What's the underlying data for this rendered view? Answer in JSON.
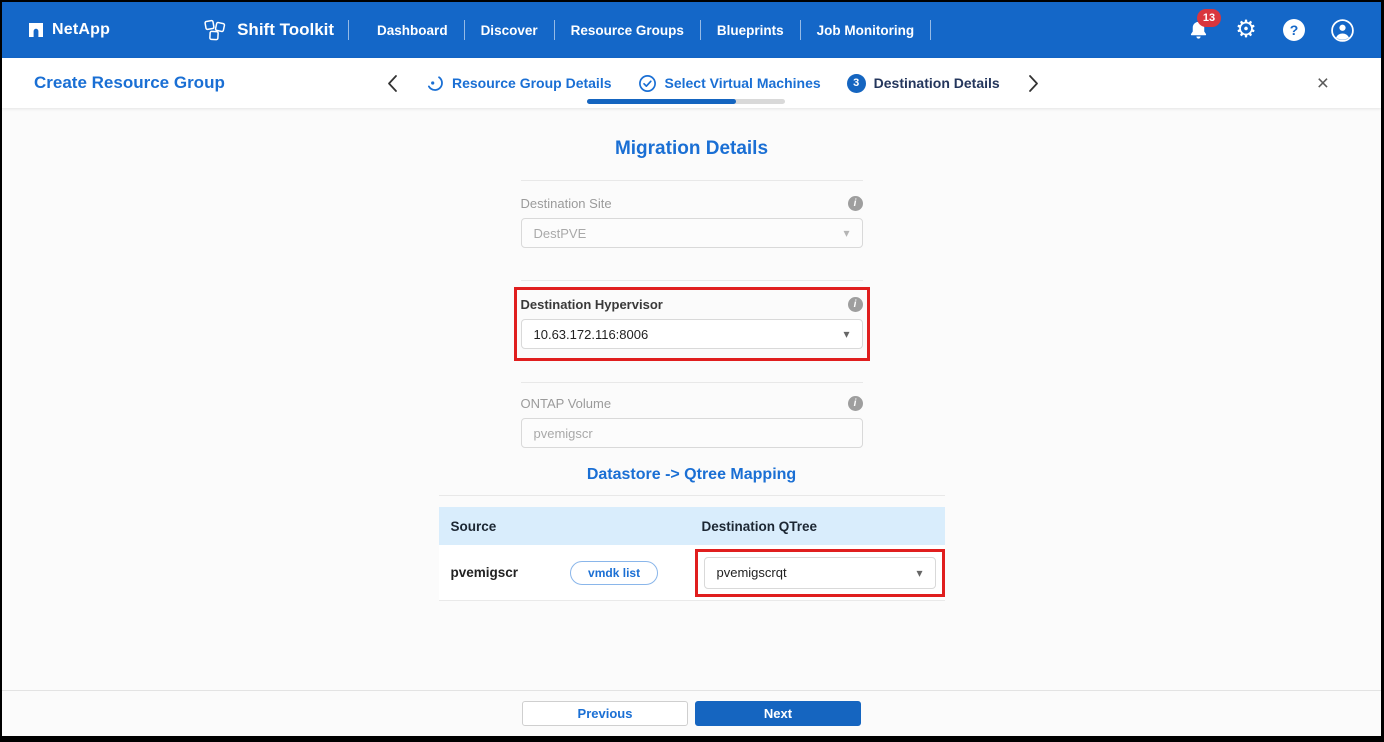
{
  "colors": {
    "navbar": "#1467c8",
    "accent": "#1a6fd4",
    "step_fill": "#1565c0",
    "annotation_red": "#e01e1e",
    "table_header_bg": "#d9edfc",
    "badge_red": "#d9363e"
  },
  "icons": {
    "close": "×",
    "caret": "▾",
    "gear": "⚙",
    "help": "?",
    "info": "i"
  },
  "navbar": {
    "brand": "NetApp",
    "app_title": "Shift Toolkit",
    "items": [
      "Dashboard",
      "Discover",
      "Resource Groups",
      "Blueprints",
      "Job Monitoring"
    ],
    "notification_count": "13"
  },
  "header": {
    "title": "Create Resource Group",
    "steps": [
      {
        "label": "Resource Group Details",
        "state": "in-progress"
      },
      {
        "label": "Select Virtual Machines",
        "state": "complete-active"
      },
      {
        "label": "Destination Details",
        "state": "upcoming",
        "number": "3"
      }
    ],
    "progress_percent": "75"
  },
  "main": {
    "section_title": "Migration Details",
    "fields": [
      {
        "label": "Destination Site",
        "value": "DestPVE",
        "disabled": true
      },
      {
        "label": "Destination Hypervisor",
        "value": "10.63.172.116:8006",
        "disabled": false,
        "highlighted": true
      },
      {
        "label": "ONTAP Volume",
        "value": "pvemigscr",
        "disabled": true
      }
    ],
    "mapping": {
      "title": "Datastore -> Qtree Mapping",
      "columns": [
        "Source",
        "Destination QTree"
      ],
      "rows": [
        {
          "source": "pvemigscr",
          "vmdk_label": "vmdk list",
          "qtree": "pvemigscrqt",
          "highlighted": true
        }
      ]
    }
  },
  "footer": {
    "previous": "Previous",
    "next": "Next"
  }
}
